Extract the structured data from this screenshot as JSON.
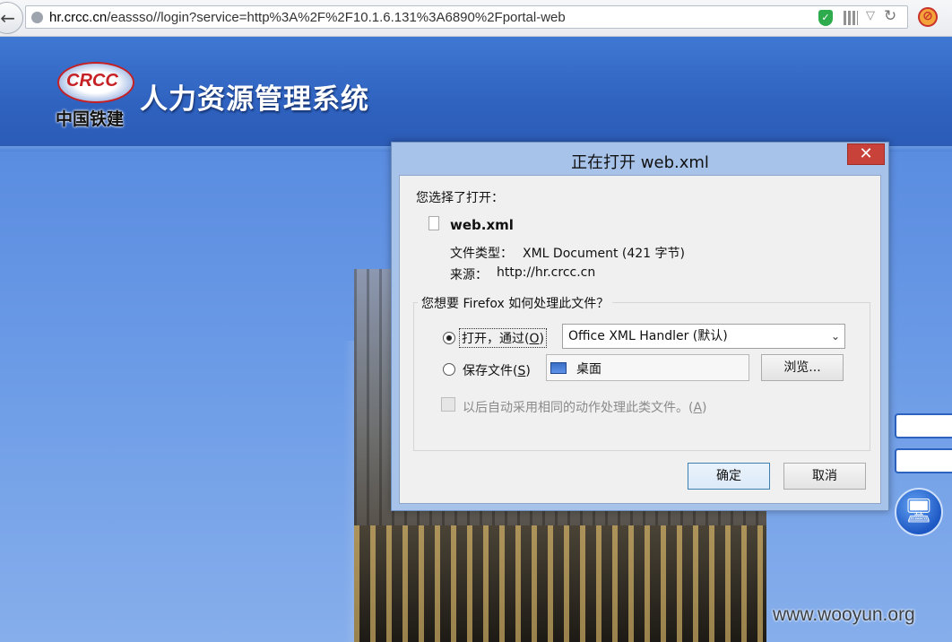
{
  "browser": {
    "url_host": "hr.crcc.cn",
    "url_path": "/eassso//login?service=http%3A%2F%2F10.1.6.131%3A6890%2Fportal-web",
    "back_glyph": "←",
    "reload_glyph": "↻",
    "dropdown_glyph": "▽",
    "shield_glyph": "✓",
    "addon_glyph": "⊘"
  },
  "site": {
    "logo_text": "CRCC",
    "logo_cn": "中国铁建",
    "system_title": "人力资源管理系统",
    "login_icon_glyph": "🖥",
    "watermark": "www.wooyun.org"
  },
  "dialog": {
    "title": "正在打开 web.xml",
    "close_glyph": "✕",
    "you_chose": "您选择了打开：",
    "file_name": "web.xml",
    "file_type_label": "文件类型：",
    "file_type_value": "XML Document (421 字节)",
    "source_label": "来源：",
    "source_value": "http://hr.crcc.cn",
    "question": "您想要 Firefox 如何处理此文件？",
    "open_with_label_pre": "打开，通过(",
    "open_with_accel": "O",
    "open_with_label_post": ")",
    "handler_selected": "Office XML Handler (默认)",
    "select_arrow": "⌄",
    "save_label_pre": "保存文件(",
    "save_accel": "S",
    "save_label_post": ")",
    "save_location": "桌面",
    "browse_label": "浏览...",
    "auto_label_pre": "以后自动采用相同的动作处理此类文件。(",
    "auto_accel": "A",
    "auto_label_post": ")",
    "ok_label": "确定",
    "cancel_label": "取消",
    "open_selected": true,
    "auto_checked": false
  },
  "colors": {
    "page_bg": "#4f84db",
    "header_bg": "#2f62bf",
    "dialog_frame": "#a7c3ea",
    "close_red": "#c8423a",
    "logo_red": "#c62024"
  }
}
